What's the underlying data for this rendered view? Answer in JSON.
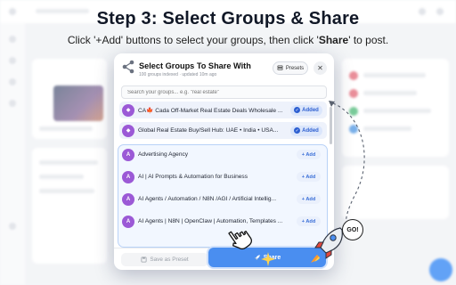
{
  "header": {
    "title": "Step 3: Select Groups & Share",
    "subtitle_part1": "Click '+Add' buttons to select your groups, then click '",
    "subtitle_bold": "Share",
    "subtitle_part2": "' to post."
  },
  "modal": {
    "title": "Select Groups To Share With",
    "subtitle": "100 groups indexed · updated 10m ago",
    "presets_label": "Presets",
    "close_glyph": "✕",
    "search_placeholder": "Search your groups... e.g. \"real estate\"",
    "groups": [
      {
        "avatar": "◆",
        "name": "CA🍁 Cada Off-Market Real Estate Deals  Wholesale ...",
        "status": "Added"
      },
      {
        "avatar": "◆",
        "name": "Global Real Estate Buy/Sell Hub: UAE • India • USA...",
        "status": "Added"
      },
      {
        "avatar": "A",
        "name": "Advertising Agency",
        "status": "+ Add"
      },
      {
        "avatar": "A",
        "name": "AI | AI Prompts & Automation for Business",
        "status": "+ Add"
      },
      {
        "avatar": "A",
        "name": "AI Agents / Automation / N8N /AGI / Artificial Intellig...",
        "status": "+ Add"
      },
      {
        "avatar": "A",
        "name": "AI Agents | N8N | OpenClaw | Automation, Templates ...",
        "status": "+ Add"
      }
    ],
    "save_preset_label": "Save as Preset",
    "share_label": "Share"
  },
  "decor": {
    "go_label": "GO!"
  },
  "colors": {
    "accent": "#4a8ef0",
    "avatar": "#9b59d6",
    "added_text": "#2d5fd1"
  }
}
